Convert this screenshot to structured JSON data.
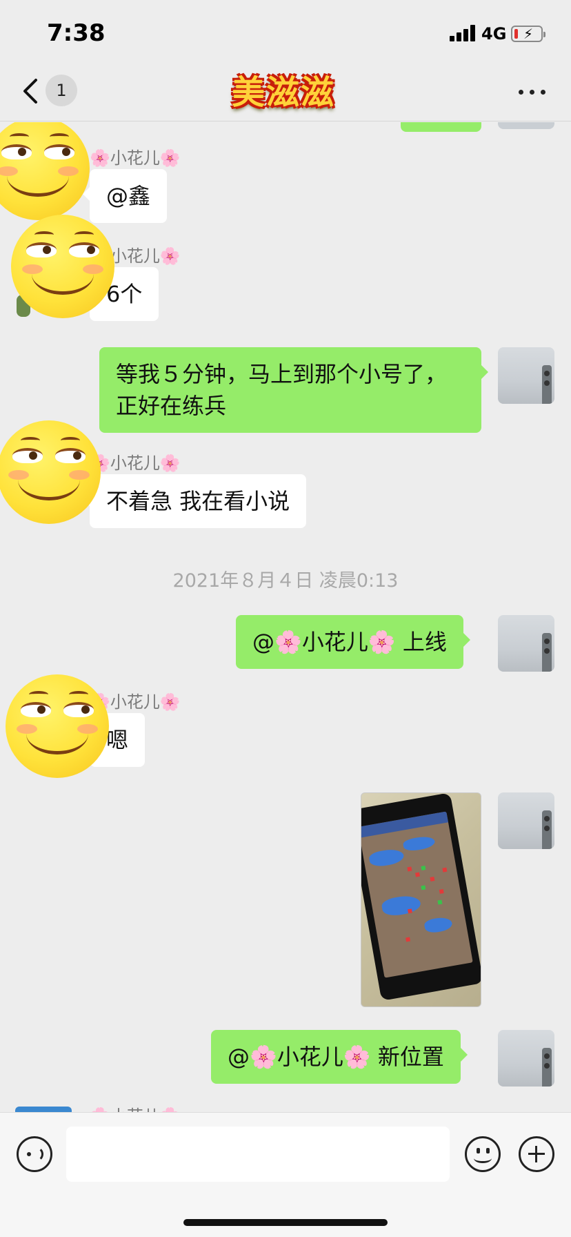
{
  "status_bar": {
    "time": "7:38",
    "network": "4G",
    "battery_level": 0.1
  },
  "nav": {
    "unread_count": "1",
    "title": "美滋滋",
    "back_icon": "chevron-left-icon",
    "more_icon": "more-dots-icon"
  },
  "messages": [
    {
      "side": "left",
      "sender": "🌸小花儿🌸",
      "text": "@鑫"
    },
    {
      "side": "left",
      "sender": "🌸小花儿🌸",
      "text": "6个"
    },
    {
      "side": "right",
      "text": "等我５分钟，马上到那个小号了，正好在练兵"
    },
    {
      "side": "left",
      "sender": "🌸小花儿🌸",
      "text": "不着急 我在看小说"
    },
    {
      "timestamp": "2021年８月４日 凌晨0:13"
    },
    {
      "side": "right",
      "text": "@🌸小花儿🌸 上线"
    },
    {
      "side": "left",
      "sender": "🌸小花儿🌸",
      "text": "嗯"
    },
    {
      "side": "right",
      "type": "image"
    },
    {
      "side": "right",
      "text": "@🌸小花儿🌸 新位置"
    },
    {
      "side": "left",
      "sender": "🌸小花儿🌸"
    }
  ],
  "input_bar": {
    "voice_icon": "voice-icon",
    "emoji_icon": "emoji-icon",
    "plus_icon": "plus-icon",
    "input_value": ""
  },
  "colors": {
    "background": "#ededed",
    "bubble_self": "#95ec69",
    "bubble_other": "#ffffff",
    "name_text": "#7b7b7b"
  }
}
